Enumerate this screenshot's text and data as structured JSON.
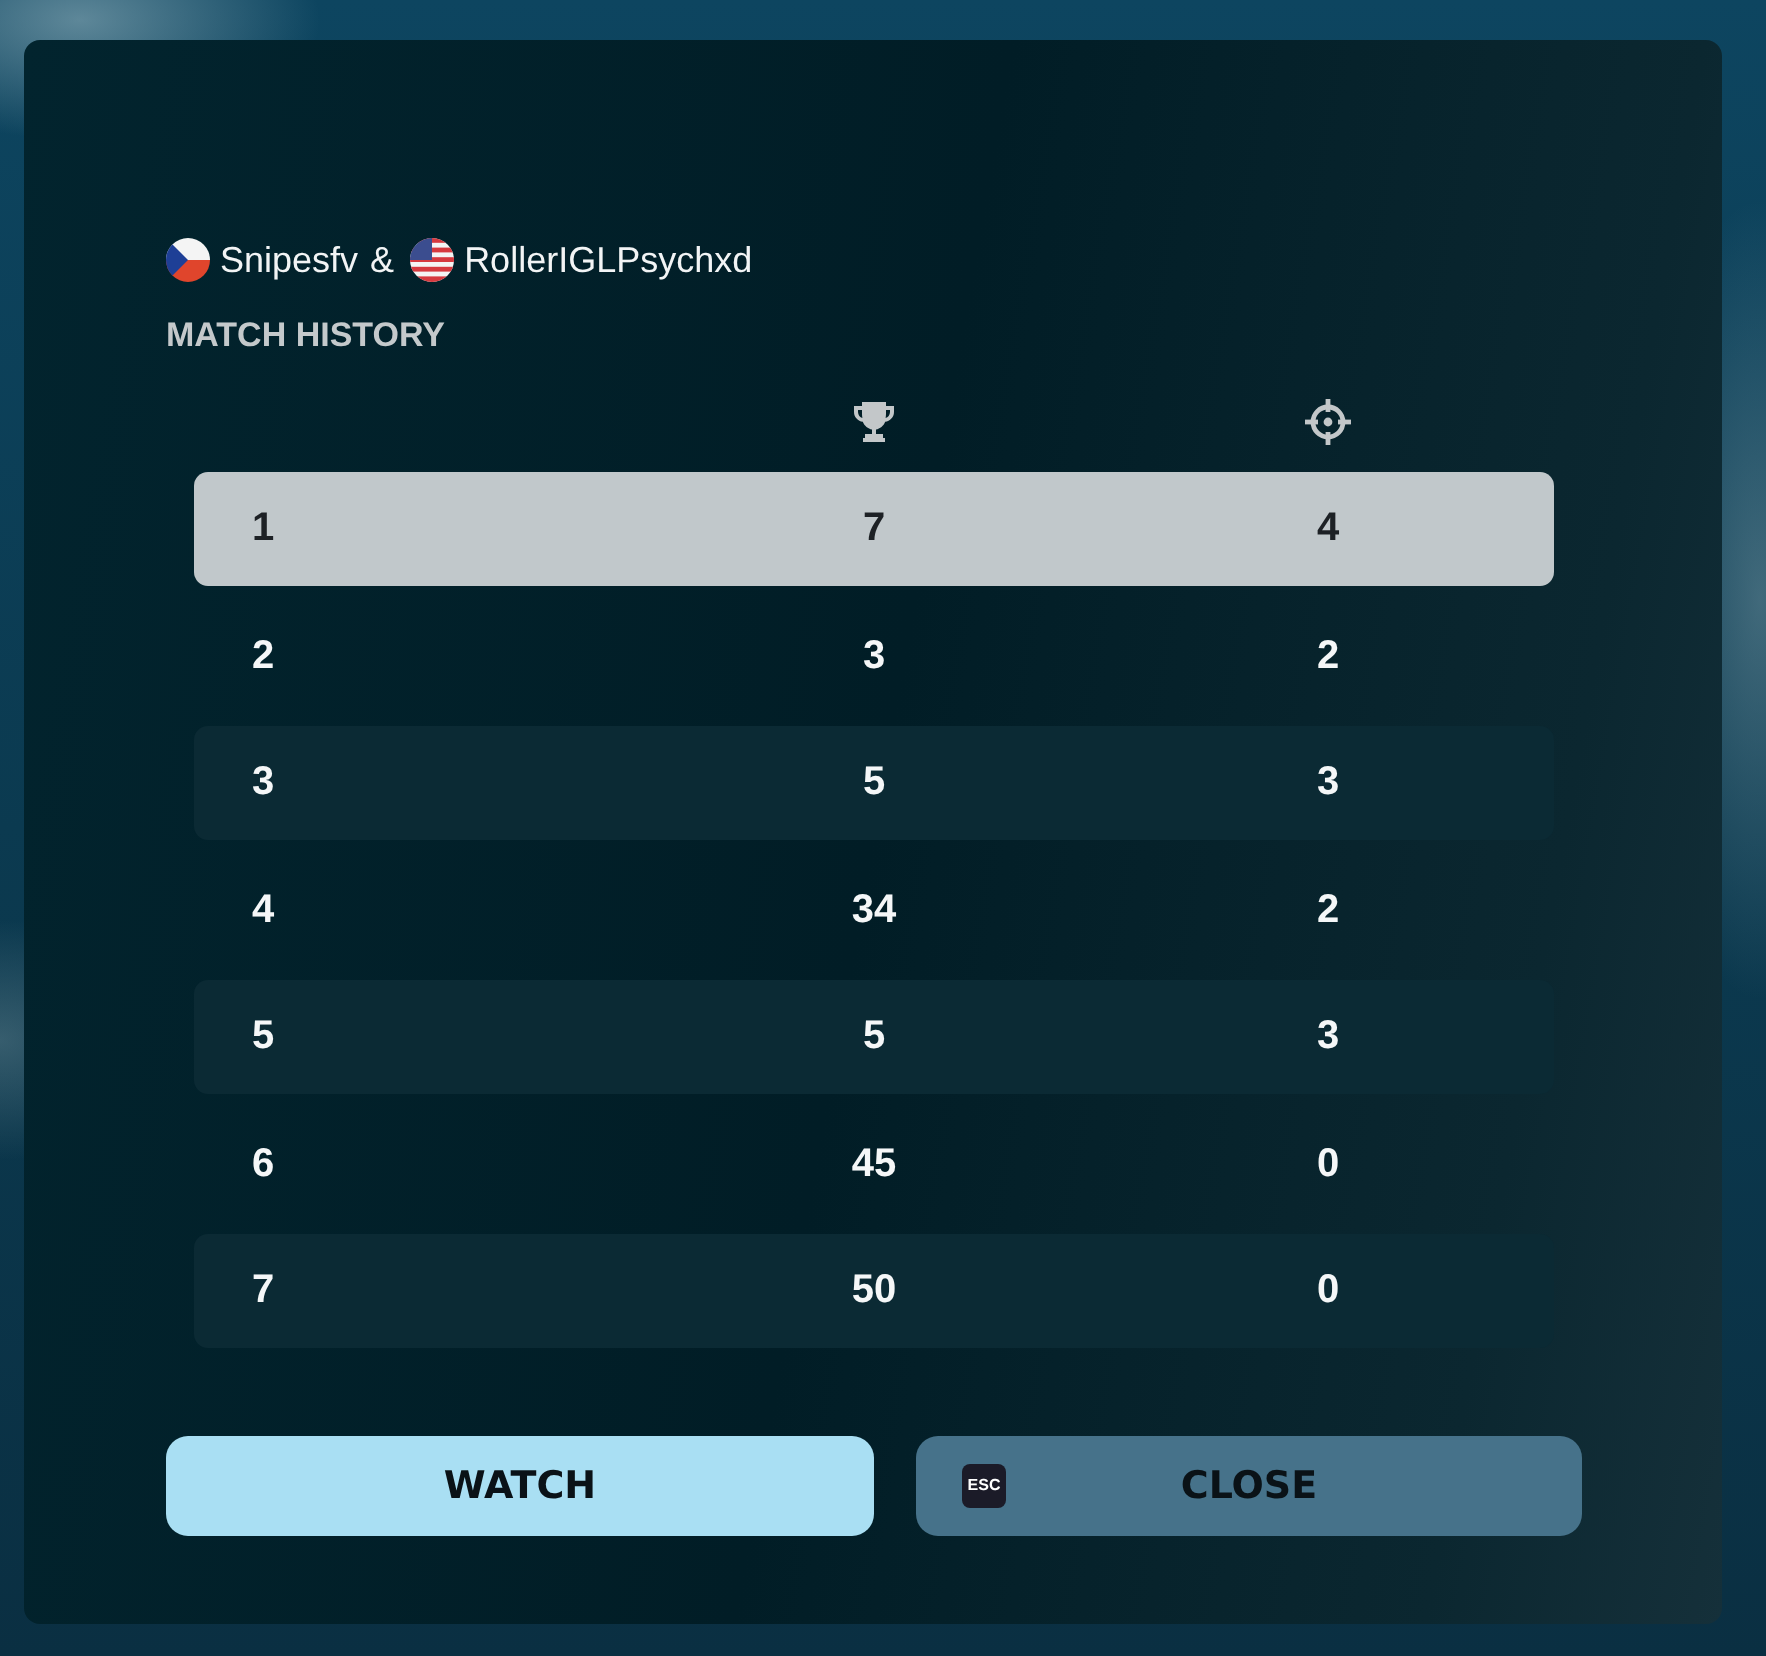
{
  "players": [
    {
      "kind": "czech",
      "name": "Snipesfv"
    },
    {
      "kind": "usa",
      "name": "RollerIGLPsychxd"
    }
  ],
  "separator": "&",
  "title": "MATCH HISTORY",
  "table": {
    "header_icons": [
      {
        "kind": "trophy"
      },
      {
        "kind": "crosshair"
      }
    ],
    "rows": [
      {
        "cells": [
          "1",
          "7",
          "4"
        ],
        "selected": true
      },
      {
        "cells": [
          "2",
          "3",
          "2"
        ],
        "selected": false
      },
      {
        "cells": [
          "3",
          "5",
          "3"
        ],
        "selected": false
      },
      {
        "cells": [
          "4",
          "34",
          "2"
        ],
        "selected": false
      },
      {
        "cells": [
          "5",
          "5",
          "3"
        ],
        "selected": false
      },
      {
        "cells": [
          "6",
          "45",
          "0"
        ],
        "selected": false
      },
      {
        "cells": [
          "7",
          "50",
          "0"
        ],
        "selected": false
      }
    ]
  },
  "buttons": [
    {
      "kind": "primary",
      "label": "WATCH"
    },
    {
      "kind": "secondary",
      "label": "CLOSE",
      "key_hint": "ESC"
    }
  ]
}
